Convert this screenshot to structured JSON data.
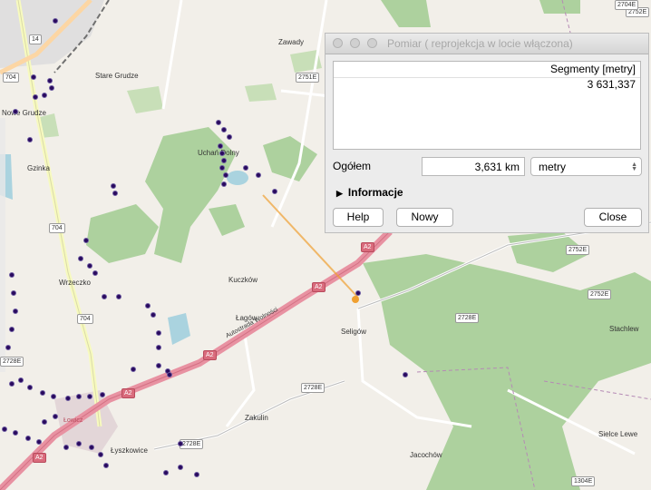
{
  "map": {
    "places": [
      {
        "name": "Zawady"
      },
      {
        "name": "Stare Grudze"
      },
      {
        "name": "Nowe Grudze"
      },
      {
        "name": "Gzinka"
      },
      {
        "name": "Uchań Dolny"
      },
      {
        "name": "Wrzeczko"
      },
      {
        "name": "Kuczków"
      },
      {
        "name": "Łagów"
      },
      {
        "name": "Seligów"
      },
      {
        "name": "Zakulin"
      },
      {
        "name": "Łyszkowice"
      },
      {
        "name": "Jacochów"
      },
      {
        "name": "Stachlew"
      },
      {
        "name": "Sielce Lewe"
      },
      {
        "name": "Łowicz"
      }
    ],
    "road_labels": [
      {
        "text": "14"
      },
      {
        "text": "704"
      },
      {
        "text": "704"
      },
      {
        "text": "704"
      },
      {
        "text": "2751E"
      },
      {
        "text": "2728E"
      },
      {
        "text": "2728E"
      },
      {
        "text": "2728E"
      },
      {
        "text": "2752E"
      },
      {
        "text": "2752E"
      },
      {
        "text": "2752E"
      },
      {
        "text": "2704E"
      },
      {
        "text": "1304E"
      },
      {
        "text": "2728E"
      },
      {
        "text": "A2",
        "style": "red"
      },
      {
        "text": "A2",
        "style": "red"
      },
      {
        "text": "A2",
        "style": "red"
      },
      {
        "text": "A2",
        "style": "red"
      },
      {
        "text": "A2",
        "style": "red"
      }
    ],
    "motorway_name": "Autostrada Wolności"
  },
  "dialog": {
    "title": "Pomiar ( reprojekcja w locie włączona)",
    "table_header": "Segmenty [metry]",
    "segments": [
      "3 631,337"
    ],
    "total_label": "Ogółem",
    "total_value": "3,631 km",
    "unit_selected": "metry",
    "info_label": "Informacje",
    "help_label": "Help",
    "new_label": "Nowy",
    "close_label": "Close"
  }
}
